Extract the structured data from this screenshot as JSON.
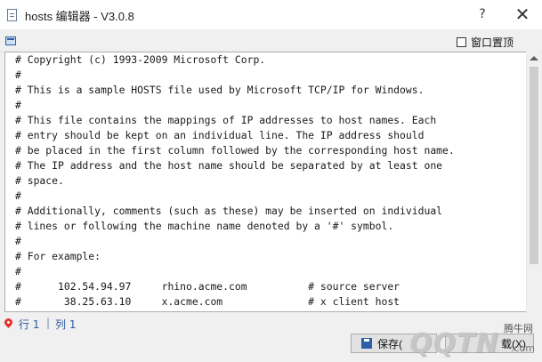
{
  "window": {
    "title": "hosts 编辑器 - V3.0.8",
    "help_symbol": "?",
    "close_symbol": "✕"
  },
  "toolbar": {
    "topmost_label": "窗口置顶",
    "topmost_checked": false
  },
  "editor": {
    "lines": [
      "# Copyright (c) 1993-2009 Microsoft Corp.",
      "#",
      "# This is a sample HOSTS file used by Microsoft TCP/IP for Windows.",
      "#",
      "# This file contains the mappings of IP addresses to host names. Each",
      "# entry should be kept on an individual line. The IP address should",
      "# be placed in the first column followed by the corresponding host name.",
      "# The IP address and the host name should be separated by at least one",
      "# space.",
      "#",
      "# Additionally, comments (such as these) may be inserted on individual",
      "# lines or following the machine name denoted by a '#' symbol.",
      "#",
      "# For example:",
      "#",
      "#      102.54.94.97     rhino.acme.com          # source server",
      "#       38.25.63.10     x.acme.com              # x client host"
    ]
  },
  "status": {
    "row_label": "行 1",
    "separator": "|",
    "col_label": "列 1",
    "save_label": "保存(",
    "other_label": "载(X)"
  },
  "watermark": {
    "cn": "腾牛网",
    "main": "QQTN",
    "com": ".com"
  },
  "colors": {
    "accent": "#2b5aa5",
    "location_icon": "#e0322d"
  }
}
